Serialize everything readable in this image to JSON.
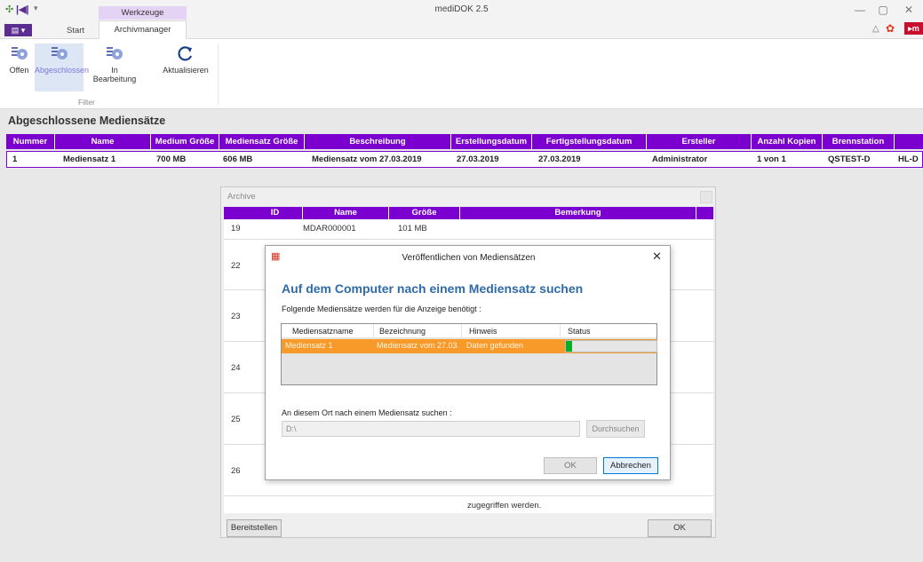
{
  "window": {
    "title": "mediDOK 2.5",
    "minimize": "—",
    "restore": "▢",
    "close": "✕"
  },
  "ribbon": {
    "context_group": "Werkzeuge",
    "tabs": [
      "Start",
      "Archivmanager"
    ],
    "active_tab": "Archivmanager",
    "buttons": {
      "offen": "Offen",
      "abgeschlossen": "Abgeschlossen",
      "in_bearbeitung_1": "In",
      "in_bearbeitung_2": "Bearbeitung",
      "aktualisieren": "Aktualisieren"
    },
    "group_label": "Filter"
  },
  "section_title": "Abgeschlossene Mediensätze",
  "main_table": {
    "headers": [
      "Nummer",
      "Name",
      "Medium Größe",
      "Mediensatz Größe",
      "Beschreibung",
      "Erstellungsdatum",
      "Fertigstellungsdatum",
      "Ersteller",
      "Anzahl Kopien",
      "Brennstation",
      ""
    ],
    "row": [
      "1",
      "Mediensatz 1",
      "700 MB",
      "606 MB",
      "Mediensatz vom 27.03.2019",
      "27.03.2019",
      "27.03.2019",
      "Administrator",
      "1 von 1",
      "QSTEST-D",
      "HL-D"
    ]
  },
  "archive": {
    "title": "Archive",
    "headers": [
      "ID",
      "Name",
      "Größe",
      "Bemerkung"
    ],
    "rows": [
      {
        "id": "19",
        "name": "MDAR000001",
        "size": "101 MB"
      },
      {
        "id": "22"
      },
      {
        "id": "23"
      },
      {
        "id": "24"
      },
      {
        "id": "25"
      },
      {
        "id": "26"
      }
    ],
    "remark_bottom": "zugegriffen werden.",
    "btn_bereitstellen": "Bereitstellen",
    "btn_ok": "OK"
  },
  "dialog": {
    "title": "Veröffentlichen von Mediensätzen",
    "heading": "Auf dem Computer nach einem Mediensatz suchen",
    "subtitle": "Folgende Mediensätze werden für die Anzeige benötigt :",
    "list_headers": [
      "Mediensatzname",
      "Bezeichnung",
      "Hinweis",
      "Status"
    ],
    "list_row": {
      "name": "Mediensatz 1",
      "bezeichnung": "Mediensatz vom 27.03.",
      "hinweis": "Daten gefunden",
      "status_progress": 0.07
    },
    "ort_label": "An diesem Ort nach einem Mediensatz suchen :",
    "ort_value": "D:\\",
    "btn_browse": "Durchsuchen",
    "btn_ok": "OK",
    "btn_cancel": "Abbrechen"
  },
  "colors": {
    "accent_purple": "#7b00d0",
    "heading_blue": "#2f6aa9",
    "row_orange": "#f79a2a",
    "progress_green": "#06b025"
  }
}
